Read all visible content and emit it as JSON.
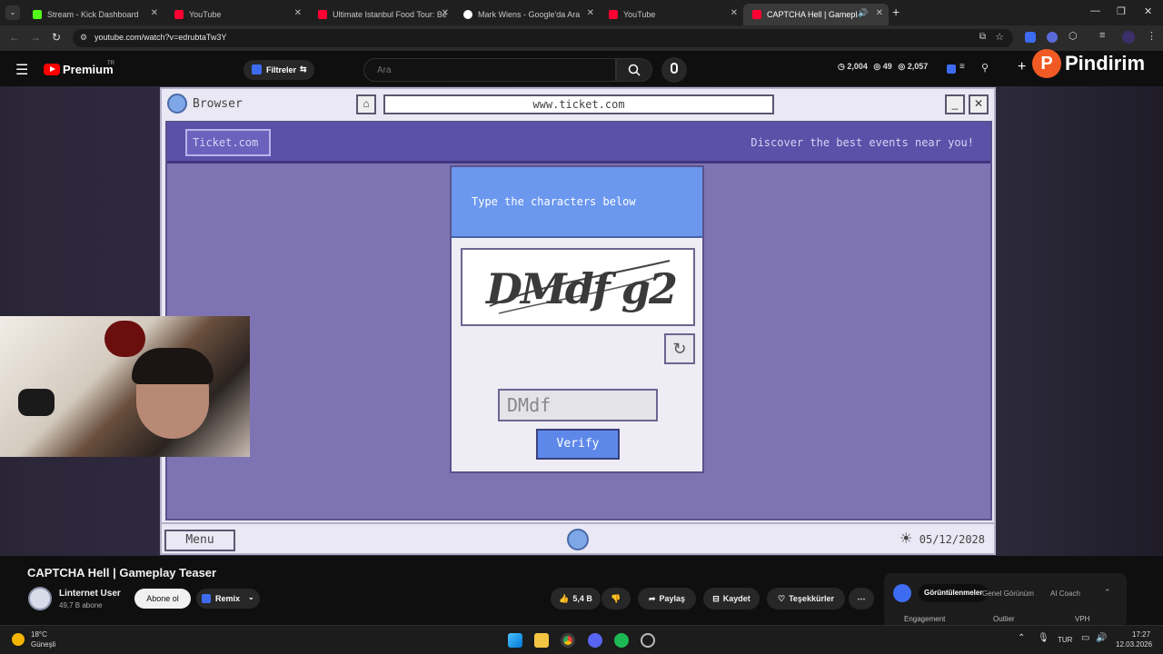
{
  "tabs": [
    {
      "title": "Stream - Kick Dashboard",
      "color": "#53fc18"
    },
    {
      "title": "YouTube",
      "color": "#ff0033"
    },
    {
      "title": "Ultimate Istanbul Food Tour: Be",
      "color": "#ff0033"
    },
    {
      "title": "Mark Wiens - Google'da Ara",
      "color": "#4285f4"
    },
    {
      "title": "YouTube",
      "color": "#ff0033"
    },
    {
      "title": "CAPTCHA Hell | Gameplay",
      "color": "#ff0033"
    }
  ],
  "address": {
    "url": "youtube.com/watch?v=edrubtaTw3Y"
  },
  "youtube": {
    "logo": "Premium",
    "region": "TR",
    "filters": "Filtreler",
    "search_placeholder": "Ara",
    "stats": {
      "a": "2,004",
      "b": "49",
      "c": "2,057"
    },
    "watermark": "Pindirim"
  },
  "game": {
    "window_title": "Browser",
    "url": "www.ticket.com",
    "site_logo": "Ticket.com",
    "tagline": "Discover the best events near you!",
    "captcha": {
      "prompt": "Type the characters below",
      "image_text": "DMdf g2",
      "input_value": "DMdf",
      "verify": "Verify"
    },
    "menu": "Menu",
    "date": "05/12/2028"
  },
  "video": {
    "title": "CAPTCHA Hell | Gameplay Teaser",
    "channel": "Linternet User",
    "subscribers": "49,7 B abone",
    "subscribe": "Abone ol",
    "remix": "Remix",
    "likes": "5,4 B",
    "share": "Paylaş",
    "save": "Kaydet",
    "thanks": "Teşekkürler"
  },
  "panel": {
    "tabs": [
      "Görüntülenmeler",
      "Genel Görünüm",
      "AI Coach"
    ],
    "cols": [
      "Engagement",
      "Outlier",
      "VPH"
    ]
  },
  "taskbar": {
    "temp": "18°C",
    "weather": "Güneşli",
    "lang": "TUR",
    "time": "17:27",
    "date": "12.03.2026"
  }
}
